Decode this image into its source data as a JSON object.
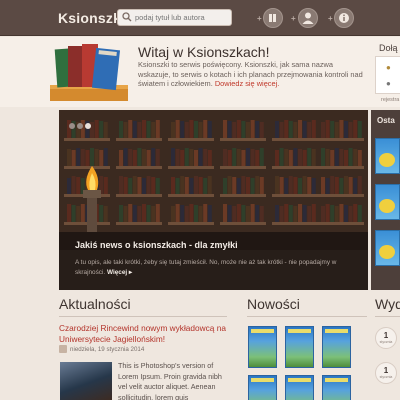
{
  "header": {
    "logo": "Ksionszki",
    "search_placeholder": "podaj tytuł lub autora",
    "icons": [
      "books-icon",
      "user-icon",
      "info-icon"
    ]
  },
  "welcome": {
    "title": "Witaj w Ksionszkach!",
    "text": "Ksionszki to serwis poświęcony. Ksionszki, jak sama nazwa wskazuje, to serwis o kotach i ich planach przejmowania kontroli nad światem i człowiekiem.",
    "link": "Dowiedz się więcej."
  },
  "sidebar": {
    "title": "Dołą",
    "register": "rejestra"
  },
  "hero": {
    "title": "Jakiś news o ksionszkach - dla zmyłki",
    "text": "A tu opis, ale taki krótki, żeby się tutaj zmieścił. No, może nie aż tak krótki - nie popadajmy w skrajności.",
    "more": "Więcej ▸",
    "slides": 3
  },
  "strip": {
    "title": "Osta"
  },
  "sections": {
    "news_title": "Aktualności",
    "new_title": "Nowości",
    "events_title": "Wyd"
  },
  "news": {
    "headline": "Czarodziej Rincewind nowym wykładowcą na Uniwersytecie Jagiellońskim!",
    "date": "niedziela, 19 stycznia 2014",
    "body": "This is Photoshop's version  of Lorem Ipsum. Proin gravida nibh vel velit auctor aliquet. Aenean sollicitudin, lorem quis"
  },
  "events": [
    {
      "day": "1",
      "month": "stycznia"
    },
    {
      "day": "1",
      "month": "stycznia"
    }
  ]
}
